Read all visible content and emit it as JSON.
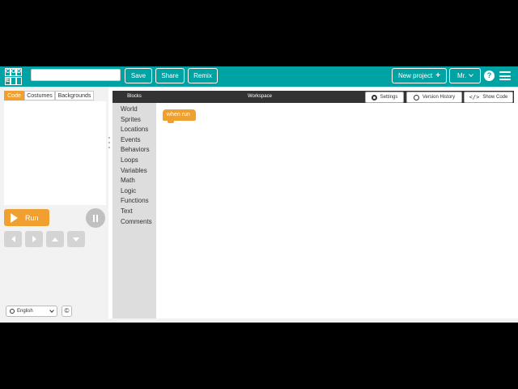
{
  "header": {
    "logo_letters": [
      "C",
      "O",
      "D",
      "E",
      "",
      ""
    ],
    "project_name": "",
    "save_label": "Save",
    "share_label": "Share",
    "remix_label": "Remix",
    "new_project_label": "New project",
    "user_label": "Mr.",
    "help_symbol": "?"
  },
  "left_panel": {
    "tabs": [
      {
        "label": "Code",
        "active": true
      },
      {
        "label": "Costumes",
        "active": false
      },
      {
        "label": "Backgrounds",
        "active": false
      }
    ],
    "run_label": "Run",
    "language": "English",
    "copyright_symbol": "©"
  },
  "toolbox": {
    "title": "Blocks",
    "categories": [
      "World",
      "Sprites",
      "Locations",
      "Events",
      "Behaviors",
      "Loops",
      "Variables",
      "Math",
      "Logic",
      "Functions",
      "Text",
      "Comments"
    ]
  },
  "workspace": {
    "title": "Workspace",
    "settings_label": "Settings",
    "version_history_label": "Version History",
    "show_code_label": "Show Code",
    "blocks": [
      {
        "label": "when run"
      }
    ]
  },
  "colors": {
    "header_bg": "#00a3a3",
    "accent_orange": "#f0a030",
    "panel_header_bg": "#333333",
    "toolbox_bg": "#dddddd"
  }
}
